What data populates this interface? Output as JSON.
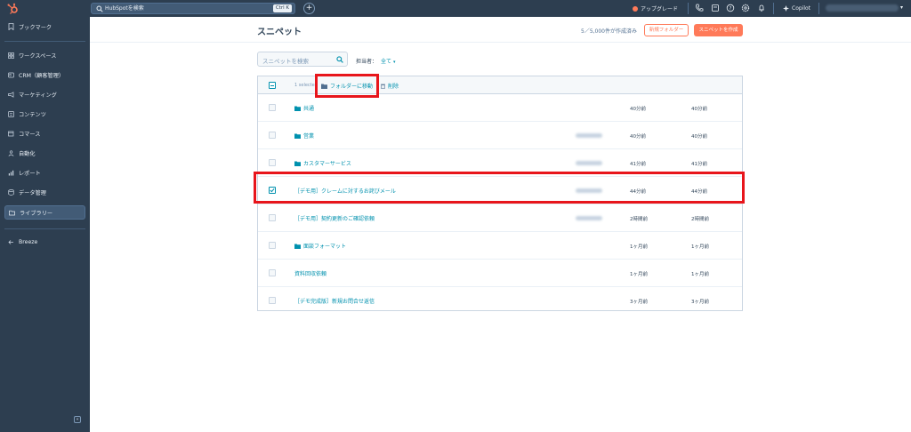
{
  "topbar": {
    "search_placeholder": "HubSpotを検索",
    "search_shortcut": "Ctrl K",
    "upgrade_label": "アップグレード",
    "copilot_label": "Copilot",
    "icons": [
      "phone-icon",
      "marketplace-icon",
      "help-icon",
      "settings-icon",
      "notifications-icon"
    ]
  },
  "sidebar": {
    "items": [
      {
        "label": "ブックマーク",
        "icon": "bookmark-icon"
      },
      {
        "label": "ワークスペース",
        "icon": "workspace-icon"
      },
      {
        "label": "CRM（顧客管理）",
        "icon": "crm-icon"
      },
      {
        "label": "マーケティング",
        "icon": "megaphone-icon"
      },
      {
        "label": "コンテンツ",
        "icon": "content-icon"
      },
      {
        "label": "コマース",
        "icon": "commerce-icon"
      },
      {
        "label": "自動化",
        "icon": "automation-icon"
      },
      {
        "label": "レポート",
        "icon": "reports-icon"
      },
      {
        "label": "データ管理",
        "icon": "data-icon"
      },
      {
        "label": "ライブラリー",
        "icon": "library-icon"
      },
      {
        "label": "Breeze",
        "icon": "breeze-icon"
      }
    ],
    "active_index": 9
  },
  "header": {
    "title": "スニペット",
    "count_text": "5／5,000件が作成済み",
    "new_folder_label": "新規フォルダー",
    "create_label": "スニペットを作成"
  },
  "filters": {
    "search_placeholder": "スニペットを検索",
    "owner_label": "担当者：",
    "owner_value": "全て"
  },
  "table": {
    "selected_text": "1 selected",
    "move_label": "フォルダーに移動",
    "delete_label": "削除",
    "rows": [
      {
        "name": "共通",
        "is_folder": true,
        "checked": false,
        "col1": "40分前",
        "col2": "40分前"
      },
      {
        "name": "営業",
        "is_folder": true,
        "checked": false,
        "col1": "40分前",
        "col2": "40分前"
      },
      {
        "name": "カスタマーサービス",
        "is_folder": true,
        "checked": false,
        "col1": "41分前",
        "col2": "41分前"
      },
      {
        "name": "［デモ用］クレームに対するお詫びメール",
        "is_folder": false,
        "checked": true,
        "col1": "44分前",
        "col2": "44分前"
      },
      {
        "name": "［デモ用］契約更新のご確認依頼",
        "is_folder": false,
        "checked": false,
        "col1": "2時間前",
        "col2": "2時間前"
      },
      {
        "name": "面談フォーマット",
        "is_folder": true,
        "checked": false,
        "col1": "1ヶ月前",
        "col2": "1ヶ月前"
      },
      {
        "name": "資料回収依頼",
        "is_folder": false,
        "checked": false,
        "col1": "1ヶ月前",
        "col2": "1ヶ月前"
      },
      {
        "name": "［デモ完成版］新規お問合せ返信",
        "is_folder": false,
        "checked": false,
        "col1": "3ヶ月前",
        "col2": "3ヶ月前"
      }
    ]
  },
  "colors": {
    "nav_bg": "#2d3e50",
    "accent": "#ff7a59",
    "link": "#0091ae",
    "highlight": "#e8151b"
  }
}
